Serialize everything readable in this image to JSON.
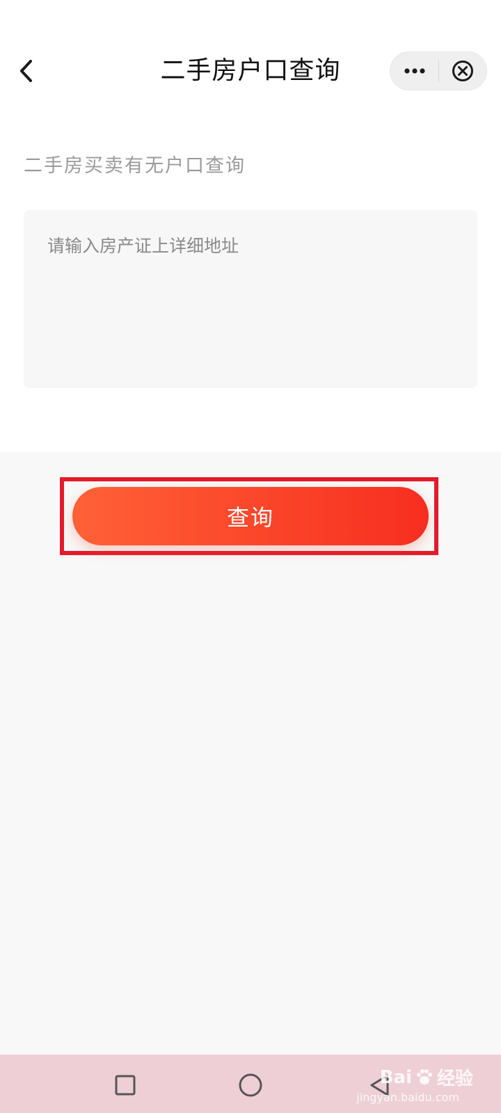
{
  "nav": {
    "title": "二手房户口查询"
  },
  "form": {
    "section_label": "二手房买卖有无户口查询",
    "address_placeholder": "请输入房产证上详细地址",
    "address_value": ""
  },
  "actions": {
    "query_label": "查询"
  },
  "watermark": {
    "brand": "Bai",
    "suffix": "经验",
    "site": "jingyan.baidu.com"
  },
  "colors": {
    "accent_start": "#ff6137",
    "accent_end": "#f72e1f",
    "highlight": "#e31b2b"
  },
  "icons": {
    "back": "chevron-left-icon",
    "more": "more-dots-icon",
    "close": "close-circle-icon",
    "recent": "square-icon",
    "home": "circle-icon",
    "sys_back": "triangle-back-icon"
  }
}
